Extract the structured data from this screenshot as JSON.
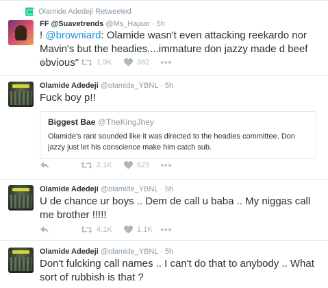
{
  "tweets": [
    {
      "context": "Olamide Adedeji Retweeted",
      "name": "FF @Suavetrends",
      "handle": "@Ms_Hajaar",
      "time": "5h",
      "text_lead": "! ",
      "mention": "@browniard",
      "text_rest": ": Olamide wasn't even attacking reekardo nor Mavin's but the headies....immature don jazzy made d beef obvious\"",
      "retweets": "1.9K",
      "likes": "382"
    },
    {
      "name": "Olamide Adedeji",
      "handle": "@olamide_YBNL",
      "time": "5h",
      "text": "Fuck boy p!!",
      "quote": {
        "name": "Biggest Bae",
        "handle": "@TheKingJhey",
        "text": "Olamide's rant sounded like it was directed to the headies committee. Don jazzy just let his conscience make him catch sub."
      },
      "retweets": "2.1K",
      "likes": "525"
    },
    {
      "name": "Olamide Adedeji",
      "handle": "@olamide_YBNL",
      "time": "5h",
      "text": "U de chance ur boys .. Dem de call u baba .. My niggas call me brother !!!!!",
      "retweets": "4.1K",
      "likes": "1.1K"
    },
    {
      "name": "Olamide Adedeji",
      "handle": "@olamide_YBNL",
      "time": "5h",
      "text": "Don't fulcking call names .. I can't do that to anybody .. What sort of rubbish is that ?"
    }
  ],
  "icons": [
    "retweet-badge-icon",
    "reply-icon",
    "retweet-icon",
    "like-icon",
    "more-icon"
  ],
  "colors": {
    "mention": "#1b95e0",
    "retweet_badge": "#19cf86",
    "muted": "#8899a6",
    "border": "#e1e8ed"
  }
}
